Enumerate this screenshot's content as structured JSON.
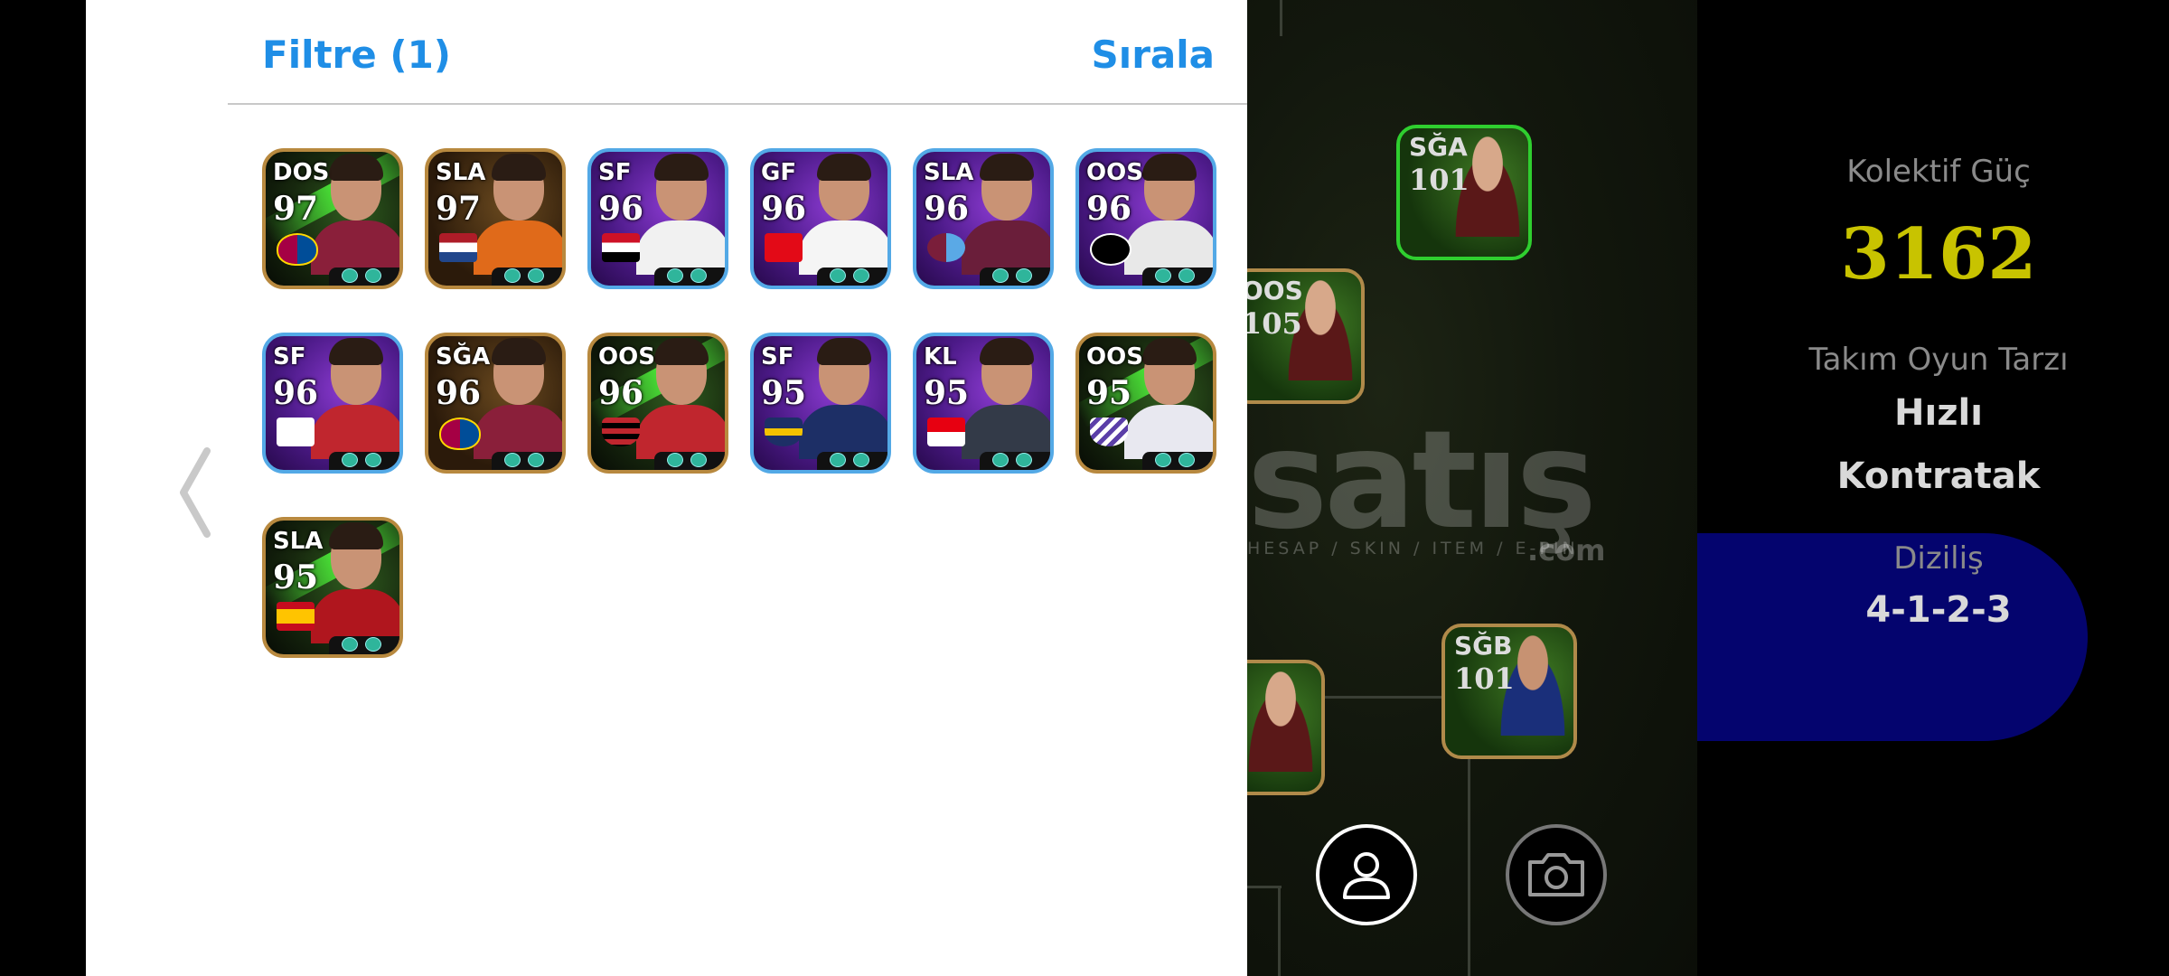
{
  "panel": {
    "filter_label": "Filtre (1)",
    "sort_label": "Sırala"
  },
  "cards": [
    {
      "position": "DOS",
      "rating": "97",
      "style": "legend",
      "badge": "barcelona",
      "kit": "#8a1f3a"
    },
    {
      "position": "SLA",
      "rating": "97",
      "style": "orange",
      "badge": "netherlands",
      "kit": "#e06a1a"
    },
    {
      "position": "SF",
      "rating": "96",
      "style": "epic",
      "badge": "iraq",
      "kit": "#f1f1f1"
    },
    {
      "position": "GF",
      "rating": "96",
      "style": "epic",
      "badge": "turkey",
      "kit": "#f5f5f5"
    },
    {
      "position": "SLA",
      "rating": "96",
      "style": "epic",
      "badge": "trabzonspor",
      "kit": "#6a1e3a"
    },
    {
      "position": "OOS",
      "rating": "96",
      "style": "epic",
      "badge": "besiktas",
      "kit": "#e8e8e8"
    },
    {
      "position": "SF",
      "rating": "96",
      "style": "epic",
      "badge": "south-korea",
      "kit": "#c0262e"
    },
    {
      "position": "SĞA",
      "rating": "96",
      "style": "orange",
      "badge": "barcelona",
      "kit": "#8a1f3a"
    },
    {
      "position": "OOS",
      "rating": "96",
      "style": "legend",
      "badge": "flamengo",
      "kit": "#c0262e"
    },
    {
      "position": "SF",
      "rating": "95",
      "style": "epic",
      "badge": "boca-juniors",
      "kit": "#1d2f66"
    },
    {
      "position": "KL",
      "rating": "95",
      "style": "epic",
      "badge": "indonesia",
      "kit": "#333a48"
    },
    {
      "position": "OOS",
      "rating": "95",
      "style": "legend",
      "badge": "beitar",
      "kit": "#e8e8f0"
    },
    {
      "position": "SLA",
      "rating": "95",
      "style": "legend",
      "badge": "spain",
      "kit": "#b0161e"
    }
  ],
  "formation_cards": [
    {
      "position": "SĞA",
      "rating": "101"
    },
    {
      "position": "OOS",
      "rating": "105"
    },
    {
      "position": "SĞB",
      "rating": "101"
    }
  ],
  "watermark": {
    "text": "satış",
    "sub": "HESAP / SKIN / ITEM / E-PIN",
    "com": ".com"
  },
  "stats": {
    "collective_label": "Kolektif Güç",
    "collective_value": "3162",
    "style_label": "Takım Oyun Tarzı",
    "style_value_1": "Hızlı",
    "style_value_2": "Kontratak",
    "formation_label": "Diziliş",
    "formation_value": "4-1-2-3"
  },
  "colors": {
    "accent": "#1f8ee6",
    "power": "#c8c300",
    "formation_pill": "#04046e"
  },
  "icons": {
    "back": "chevron-left-icon",
    "player": "person-icon",
    "camera": "camera-icon"
  }
}
